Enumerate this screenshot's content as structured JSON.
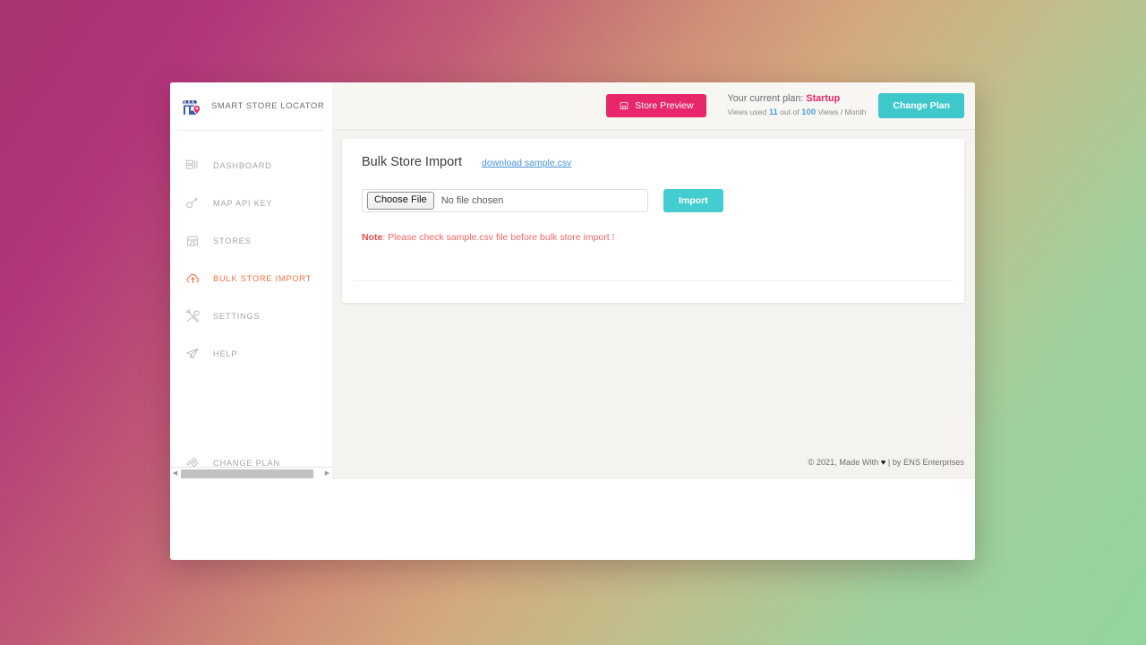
{
  "brand": {
    "name": "SMART STORE LOCATOR",
    "logo_icon": "store-pin-logo-icon"
  },
  "sidebar": {
    "items": [
      {
        "label": "DASHBOARD",
        "icon": "dashboard-icon",
        "active": false
      },
      {
        "label": "MAP API KEY",
        "icon": "key-icon",
        "active": false
      },
      {
        "label": "STORES",
        "icon": "store-icon",
        "active": false
      },
      {
        "label": "BULK STORE IMPORT",
        "icon": "cloud-upload-icon",
        "active": true
      },
      {
        "label": "SETTINGS",
        "icon": "tools-icon",
        "active": false
      },
      {
        "label": "HELP",
        "icon": "paper-plane-icon",
        "active": false
      }
    ],
    "bottom_item": {
      "label": "CHANGE PLAN",
      "icon": "rocket-icon"
    },
    "scrollbar": {
      "left_arrow": "◀",
      "right_arrow": "▶"
    }
  },
  "topbar": {
    "store_preview_label": "Store Preview",
    "store_preview_icon": "store-icon",
    "plan_prefix": "Your current plan: ",
    "plan_name": "Startup",
    "views_used_prefix": "Views used ",
    "views_used": "11",
    "views_mid": " out of ",
    "views_total": "100",
    "views_suffix": " Views / Month",
    "change_plan_label": "Change Plan"
  },
  "card": {
    "title": "Bulk Store Import",
    "sample_link": "download sample.csv",
    "file_input": {
      "button_label": "Choose File",
      "value": "No file chosen"
    },
    "import_label": "Import",
    "note_label": "Note",
    "note_text": ": Please check sample.csv file before bulk store import !"
  },
  "footer": {
    "prefix": "© 2021, Made With ",
    "heart": "♥",
    "suffix": " | by ENS Enterprises"
  },
  "colors": {
    "accent_pink": "#e8276b",
    "accent_teal": "#3ec8cc",
    "active_orange": "#f4713c",
    "link_blue": "#4a90d9",
    "note_red": "#ef6565"
  }
}
